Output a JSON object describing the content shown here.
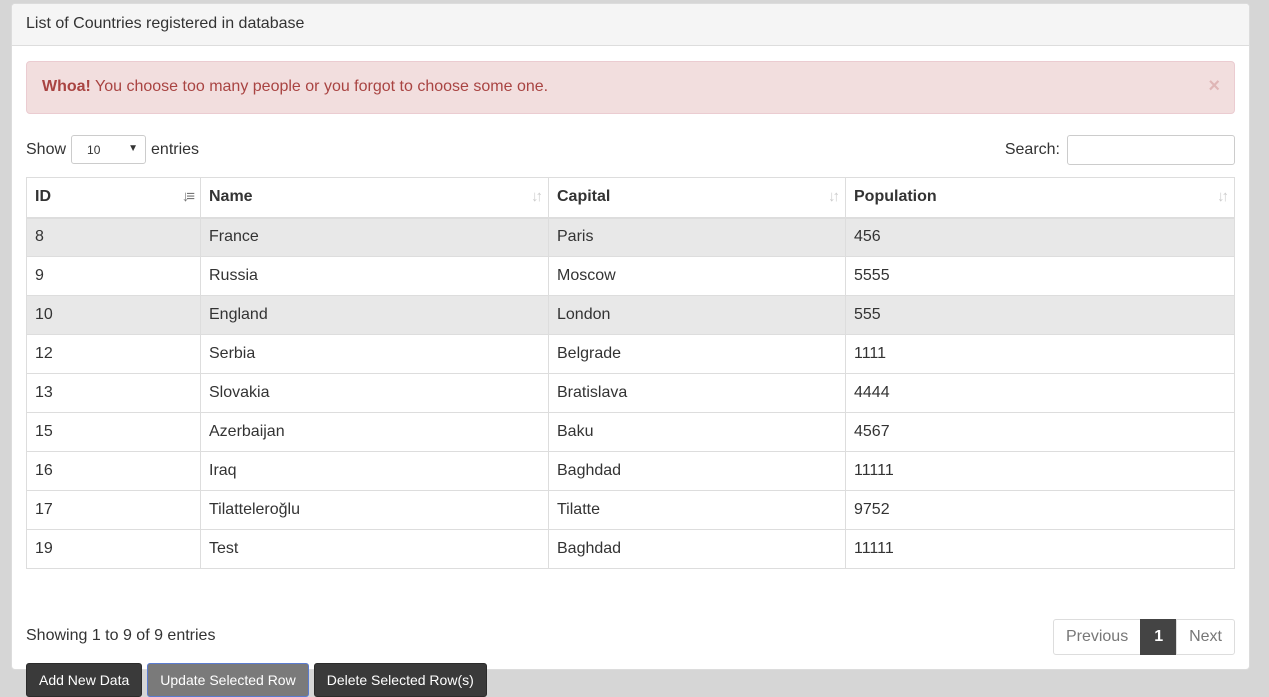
{
  "panel": {
    "title": "List of Countries registered in database"
  },
  "alert": {
    "strong": "Whoa!",
    "message": "You choose too many people or you forgot to choose some one.",
    "close": "×"
  },
  "length": {
    "show": "Show",
    "value": "10",
    "entries": "entries"
  },
  "search": {
    "label": "Search:",
    "value": ""
  },
  "table": {
    "headers": [
      "ID",
      "Name",
      "Capital",
      "Population"
    ],
    "rows": [
      {
        "id": "8",
        "name": "France",
        "capital": "Paris",
        "population": "456"
      },
      {
        "id": "9",
        "name": "Russia",
        "capital": "Moscow",
        "population": "5555"
      },
      {
        "id": "10",
        "name": "England",
        "capital": "London",
        "population": "555"
      },
      {
        "id": "12",
        "name": "Serbia",
        "capital": "Belgrade",
        "population": "1111"
      },
      {
        "id": "13",
        "name": "Slovakia",
        "capital": "Bratislava",
        "population": "4444"
      },
      {
        "id": "15",
        "name": "Azerbaijan",
        "capital": "Baku",
        "population": "4567"
      },
      {
        "id": "16",
        "name": "Iraq",
        "capital": "Baghdad",
        "population": "11111"
      },
      {
        "id": "17",
        "name": "Tilatteleroğlu",
        "capital": "Tilatte",
        "population": "9752"
      },
      {
        "id": "19",
        "name": "Test",
        "capital": "Baghdad",
        "population": "11111"
      }
    ]
  },
  "info": "Showing 1 to 9 of 9 entries",
  "pagination": {
    "previous": "Previous",
    "current": "1",
    "next": "Next"
  },
  "buttons": {
    "add": "Add New Data",
    "update": "Update Selected Row",
    "delete": "Delete Selected Row(s)"
  },
  "colors": {
    "alert_bg": "#f2dede",
    "alert_text": "#a94442",
    "button_dark": "#3a3a3a",
    "active_page": "#444444"
  }
}
